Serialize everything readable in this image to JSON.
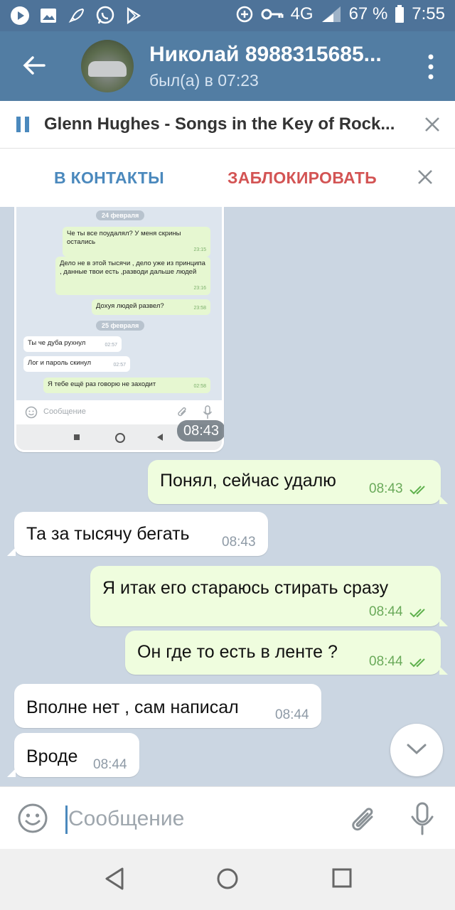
{
  "status_bar": {
    "battery": "67 %",
    "time": "7:55",
    "network": "4G"
  },
  "header": {
    "name": "Николай 8988315685...",
    "status": "был(а) в 07:23"
  },
  "player": {
    "title": "Glenn Hughes - Songs in the Key of Rock..."
  },
  "action_bar": {
    "add_contact": "В КОНТАКТЫ",
    "block": "ЗАБЛОКИРОВАТЬ"
  },
  "screenshot": {
    "date1": "24 февраля",
    "date2": "25 февраля",
    "messages": [
      {
        "text": "Че ты все поудалял? У меня скрины остались",
        "time": "23:15"
      },
      {
        "text": "Дело не в этой тысячи , дело уже из принципа , данные твои есть ,разводи дальше людей",
        "time": "23:16"
      },
      {
        "text": "Дохуя людей развел?",
        "time": "23:58"
      },
      {
        "text": "Ты че дуба рухнул",
        "time": "02:57"
      },
      {
        "text": "Лог и пароль скинул",
        "time": "02:57"
      },
      {
        "text": "Я тебе ещё раз говорю не заходит",
        "time": "02:58"
      }
    ],
    "input_placeholder": "Сообщение",
    "time": "08:43"
  },
  "messages": [
    {
      "text": "Понял, сейчас удалю",
      "time": "08:43"
    },
    {
      "text": "Та за тысячу бегать",
      "time": "08:43"
    },
    {
      "text": "Я итак его стараюсь стирать сразу",
      "time": "08:44"
    },
    {
      "text": "Он где то есть в ленте ?",
      "time": "08:44"
    },
    {
      "text": "Вполне нет , сам написал",
      "time": "08:44"
    },
    {
      "text": "Вроде",
      "time": "08:44"
    }
  ],
  "composer": {
    "placeholder": "Сообщение"
  }
}
